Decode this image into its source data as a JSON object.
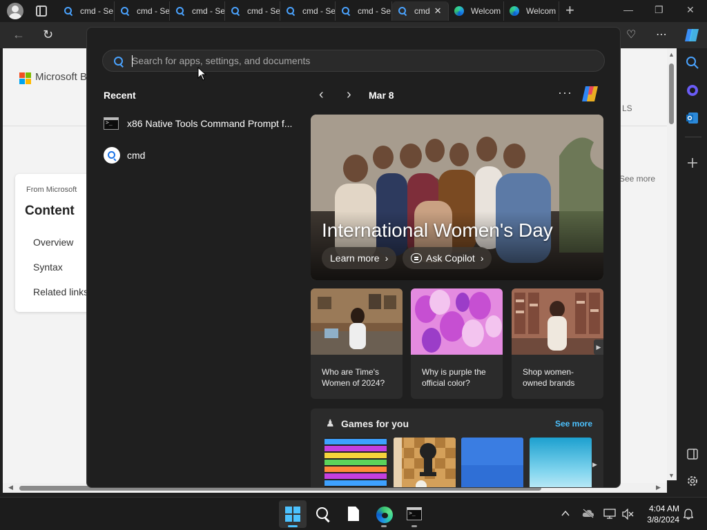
{
  "browser": {
    "tabs": [
      {
        "label": "cmd - Se",
        "icon": "search-icon"
      },
      {
        "label": "cmd - Se",
        "icon": "search-icon"
      },
      {
        "label": "cmd - Se",
        "icon": "search-icon"
      },
      {
        "label": "cmd - Se",
        "icon": "search-icon"
      },
      {
        "label": "cmd - Se",
        "icon": "search-icon"
      },
      {
        "label": "cmd - Se",
        "icon": "search-icon"
      },
      {
        "label": "cmd",
        "icon": "search-icon",
        "active": true,
        "close": "✕"
      },
      {
        "label": "Welcom",
        "icon": "edge-icon"
      },
      {
        "label": "Welcom",
        "icon": "edge-icon"
      }
    ],
    "new_tab": "+",
    "window_controls": {
      "minimize": "—",
      "maximize": "❐",
      "close": "✕"
    },
    "nav": {
      "back": "←",
      "refresh": "↻"
    },
    "toolbar_right": {
      "health": "♡",
      "more": "⋯"
    }
  },
  "page": {
    "brand": "Microsoft B",
    "right_text": "LS",
    "see_more_partial": "See more",
    "content_card": {
      "eyebrow": "From Microsoft",
      "title": "Content",
      "links": [
        "Overview",
        "Syntax",
        "Related links"
      ]
    }
  },
  "flyout": {
    "search": {
      "placeholder": "Search for apps, settings, and documents",
      "value": ""
    },
    "recent": {
      "title": "Recent",
      "items": [
        {
          "label": "x86 Native Tools Command Prompt f...",
          "icon": "terminal-icon"
        },
        {
          "label": "cmd",
          "icon": "search-icon"
        }
      ]
    },
    "date": "Mar 8",
    "more": "···",
    "hero": {
      "title": "International Women's Day",
      "learn_more": "Learn more",
      "ask_copilot": "Ask Copilot"
    },
    "news": [
      {
        "text": "Who are Time's Women of 2024?"
      },
      {
        "text": "Why is purple the official color?"
      },
      {
        "text": "Shop women-owned brands"
      }
    ],
    "games": {
      "title": "Games for you",
      "see_more": "See more"
    }
  },
  "taskbar": {
    "clock_time": "4:04 AM",
    "clock_date": "3/8/2024"
  },
  "colors": {
    "accent": "#4cc2ff",
    "flyout_bg": "#1f1f1f",
    "taskbar_bg": "#1c1c1c"
  }
}
